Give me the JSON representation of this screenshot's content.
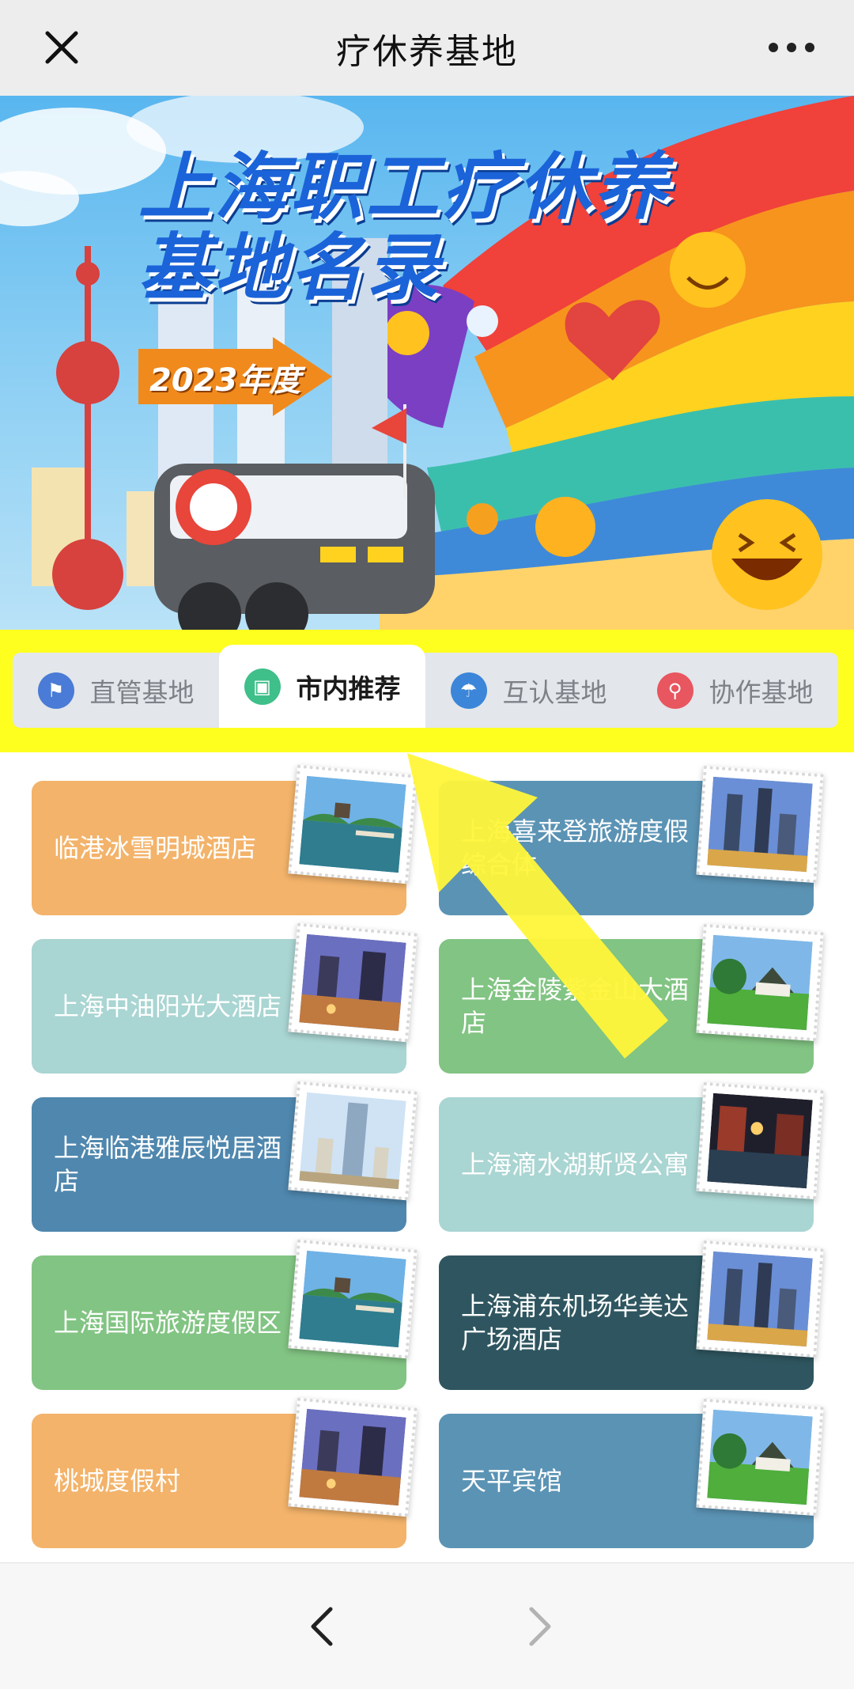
{
  "topbar": {
    "title": "疗休养基地",
    "close_icon": "close-icon",
    "more_icon": "more-icon"
  },
  "banner": {
    "headline_line1": "上海职工疗休养",
    "headline_line2": "基地名录",
    "year_label": "2023年度"
  },
  "tabs": [
    {
      "label": "直管基地",
      "icon": "flag-icon",
      "color": "#4a7bd6",
      "active": false
    },
    {
      "label": "市内推荐",
      "icon": "bag-icon",
      "color": "#3fbf8a",
      "active": true
    },
    {
      "label": "互认基地",
      "icon": "beach-icon",
      "color": "#3b86d9",
      "active": false
    },
    {
      "label": "协作基地",
      "icon": "pin-icon",
      "color": "#e8565f",
      "active": false
    }
  ],
  "cards": [
    {
      "name": "临港冰雪明城酒店",
      "color": "#f3b36a",
      "photo": "lake-bridge"
    },
    {
      "name": "上海喜来登旅游度假综合体",
      "color": "#5b93b4",
      "photo": "city-night"
    },
    {
      "name": "上海中油阳光大酒店",
      "color": "#a9d5d2",
      "photo": "plaza-dusk"
    },
    {
      "name": "上海金陵紫金山大酒店",
      "color": "#82c483",
      "photo": "lawn-house"
    },
    {
      "name": "上海临港雅辰悦居酒店",
      "color": "#4f87ae",
      "photo": "tower"
    },
    {
      "name": "上海滴水湖斯贤公寓",
      "color": "#a9d5d2",
      "photo": "canal-night"
    },
    {
      "name": "上海国际旅游度假区",
      "color": "#82c483",
      "photo": "lake-bridge"
    },
    {
      "name": "上海浦东机场华美达广场酒店",
      "color": "#2f5660",
      "photo": "city-night"
    },
    {
      "name": "桃城度假村",
      "color": "#f3b36a",
      "photo": "plaza-dusk"
    },
    {
      "name": "天平宾馆",
      "color": "#5b93b4",
      "photo": "lawn-house"
    }
  ],
  "bottombar": {
    "back_icon": "chevron-left-icon",
    "forward_icon": "chevron-right-icon"
  },
  "colors": {
    "highlight": "#ffff1f",
    "arrow": "#fff53a"
  }
}
